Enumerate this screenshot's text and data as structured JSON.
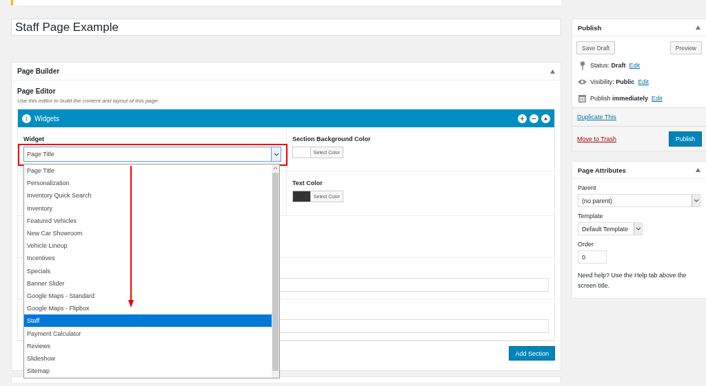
{
  "title_field": {
    "value": "Staff Page Example"
  },
  "page_builder": {
    "title": "Page Builder",
    "editor_label": "Page Editor",
    "editor_hint": "Use this editor to build the content and layout of this page.",
    "section": {
      "number": "1",
      "title": "Widgets",
      "widget_label": "Widget",
      "widget_value": "Page Title",
      "options": [
        {
          "label": "Page Title",
          "selected": false
        },
        {
          "label": "Personalization",
          "selected": false
        },
        {
          "label": "Inventory Quick Search",
          "selected": false
        },
        {
          "label": "Inventory",
          "selected": false
        },
        {
          "label": "Featured Vehicles",
          "selected": false
        },
        {
          "label": "New Car Showroom",
          "selected": false
        },
        {
          "label": "Vehicle Lineup",
          "selected": false
        },
        {
          "label": "Incentives",
          "selected": false
        },
        {
          "label": "Specials",
          "selected": false
        },
        {
          "label": "Banner Slider",
          "selected": false
        },
        {
          "label": "Google Maps - Standard",
          "selected": false
        },
        {
          "label": "Google Maps - Flipbox",
          "selected": false
        },
        {
          "label": "Staff",
          "selected": true
        },
        {
          "label": "Payment Calculator",
          "selected": false
        },
        {
          "label": "Reviews",
          "selected": false
        },
        {
          "label": "Slideshow",
          "selected": false
        },
        {
          "label": "Sitemap",
          "selected": false
        }
      ],
      "color_fields": [
        {
          "label": "Section Background Color",
          "color": "#ffffff",
          "button": "Select Color"
        },
        {
          "label": "Text Color",
          "color": "#333333",
          "button": "Select Color"
        }
      ]
    },
    "add_button": "Add Section"
  },
  "publish": {
    "title": "Publish",
    "save_draft": "Save Draft",
    "preview": "Preview",
    "status": [
      {
        "kind": "pin",
        "text": "Status: **Draft**",
        "link": "Edit"
      },
      {
        "kind": "eye",
        "text": "Visibility: **Public**",
        "link": "Edit"
      },
      {
        "kind": "calendar",
        "text": "Publish **immediately**",
        "link": "Edit"
      }
    ],
    "duplicate_link": "Duplicate This",
    "trash_link": "Move to Trash",
    "publish_button": "Publish"
  },
  "page_attributes": {
    "title": "Page Attributes",
    "parent_label": "Parent",
    "parent_value": "(no parent)",
    "template_label": "Template",
    "template_value": "Default Template",
    "order_label": "Order",
    "order_value": "0",
    "help": "Need help? Use the Help tab above the screen title."
  }
}
